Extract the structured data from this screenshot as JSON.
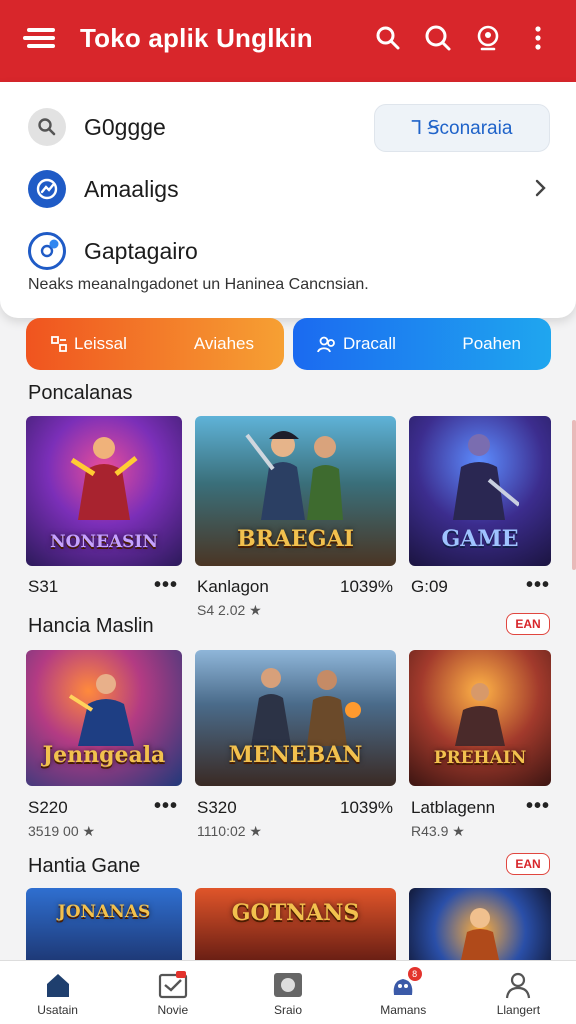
{
  "appbar": {
    "title": "Toko aplik Unglkin"
  },
  "panel": {
    "search_label": "G0ggge",
    "chip_label": "Ꞁ Ꞩconaraia",
    "row2_label": "Amaaligs",
    "row3_label": "Gaptagairo",
    "subtext": "Neaks meanaIngadonet un Haninea Cancnsian."
  },
  "actions": {
    "left_a": "Leissal",
    "left_b": "Aviahes",
    "right_a": "Dracall",
    "right_b": "Poahen"
  },
  "sections": [
    {
      "title": "Poncalanas",
      "cards": [
        {
          "art": "NONEASIN",
          "meta": "S31",
          "meta2": ""
        },
        {
          "art": "BRAEGAI",
          "meta": "Kanlagon",
          "pct": "1039%",
          "meta2": "S4 2.02 ★"
        },
        {
          "art": "GAME",
          "meta": "G:09",
          "meta2": ""
        }
      ]
    },
    {
      "title": "Hancia Maslin",
      "badge": "EAN",
      "cards": [
        {
          "art": "Jenngeala",
          "meta": "S220",
          "meta2": "3519 00 ★"
        },
        {
          "art": "MENEBAN",
          "meta": "S320",
          "pct": "1039%",
          "meta2": "1110:02 ★"
        },
        {
          "art": "PREHAIN",
          "meta": "Latblagenn",
          "meta2": "R43.9 ★"
        }
      ]
    },
    {
      "title": "Hantia Gane",
      "badge": "EAN",
      "cards": [
        {
          "art": "JONANAS"
        },
        {
          "art": "GOTNANS"
        },
        {
          "art": ""
        }
      ]
    }
  ],
  "bottom_nav": [
    {
      "label": "Usatain",
      "icon": "home-icon"
    },
    {
      "label": "Novie",
      "icon": "mail-icon"
    },
    {
      "label": "Sraio",
      "icon": "screen-icon"
    },
    {
      "label": "Mamans",
      "icon": "notification-icon",
      "badge": "8"
    },
    {
      "label": "Llangert",
      "icon": "profile-icon"
    }
  ],
  "colors": {
    "brand": "#d8262b",
    "accent_orange": "#f0541f",
    "accent_blue": "#1b6af0"
  }
}
